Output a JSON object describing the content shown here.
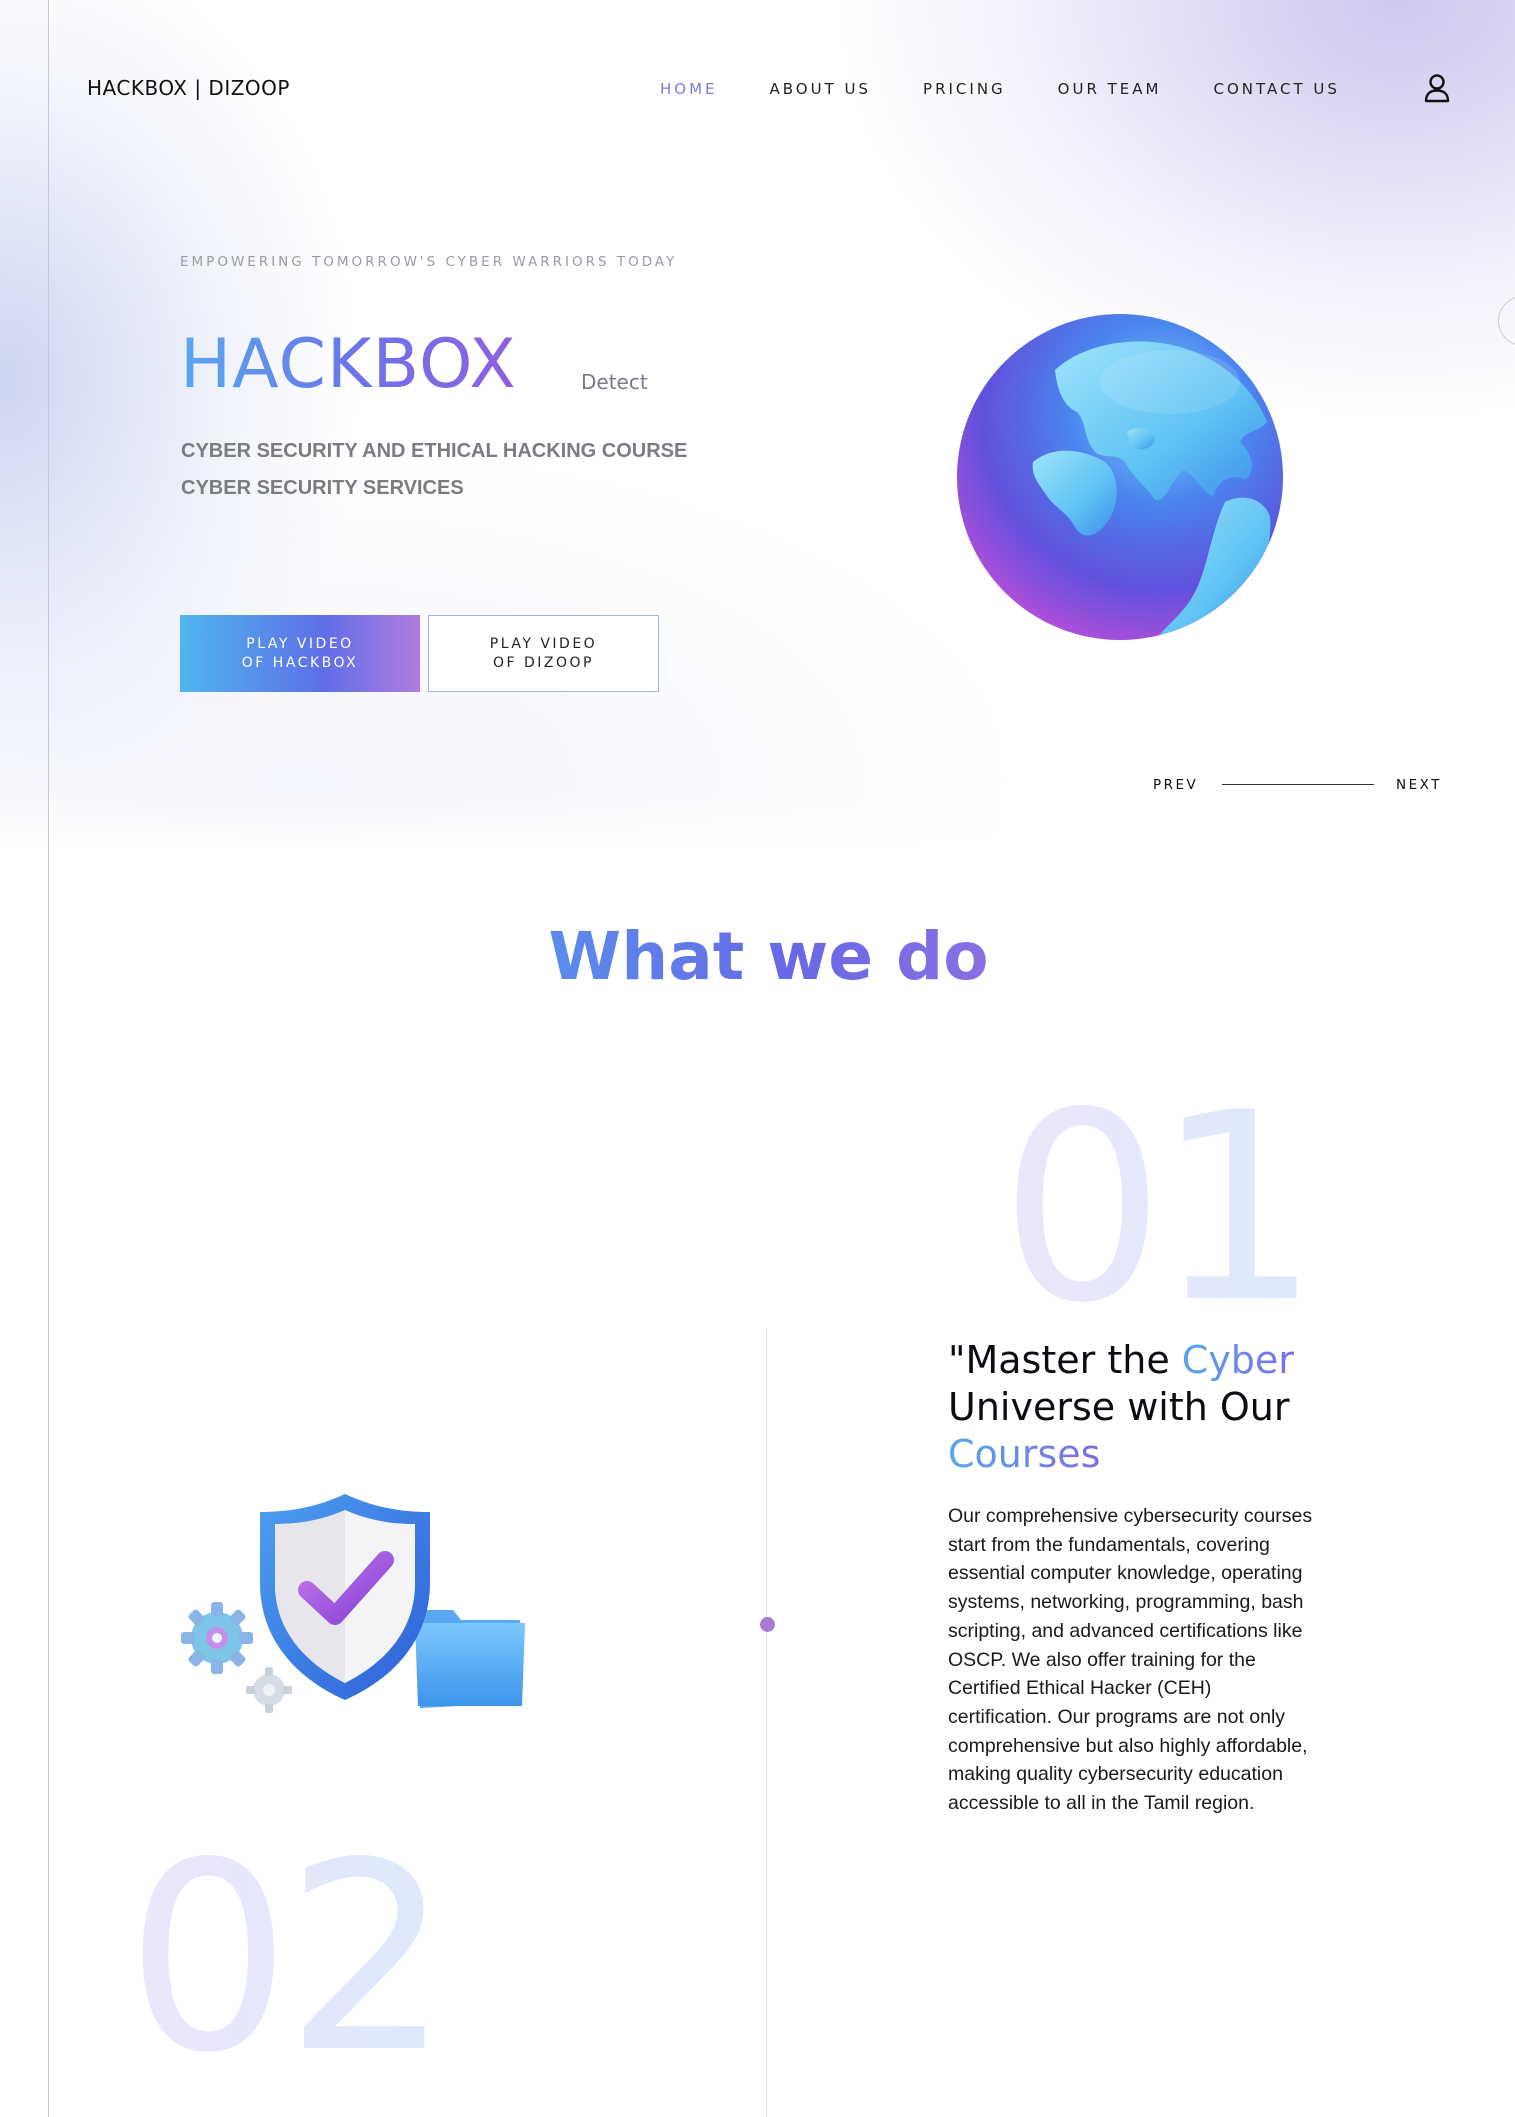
{
  "header": {
    "logo": "HACKBOX | DIZOOP",
    "nav": [
      {
        "label": "HOME",
        "active": true
      },
      {
        "label": "ABOUT US",
        "active": false
      },
      {
        "label": "PRICING",
        "active": false
      },
      {
        "label": "OUR TEAM",
        "active": false
      },
      {
        "label": "CONTACT US",
        "active": false
      }
    ],
    "user_icon": "user-icon"
  },
  "hero": {
    "eyebrow": "EMPOWERING TOMORROW'S CYBER WARRIORS TODAY",
    "title": "HACKBOX",
    "title_suffix": "Detect",
    "taglines": [
      "CYBER SECURITY AND ETHICAL HACKING COURSE",
      "CYBER SECURITY SERVICES"
    ],
    "primary_button": "PLAY VIDEO\nOF HACKBOX",
    "secondary_button": "PLAY VIDEO\nOF DIZOOP",
    "image": "globe-icon",
    "pager": {
      "prev": "PREV",
      "next": "NEXT"
    }
  },
  "what_we_do": {
    "title": "What we do",
    "items": [
      {
        "number": "01",
        "title_parts": [
          "\"Master the ",
          "Cyber",
          " Universe with Our ",
          "Courses"
        ],
        "body": "Our comprehensive cybersecurity courses start from the fundamentals, covering essential computer knowledge, operating systems, networking, programming, bash scripting, and advanced certifications like OSCP. We also offer training for the Certified Ethical Hacker (CEH) certification. Our programs are not only comprehensive but also highly affordable, making quality cybersecurity education accessible to all in the Tamil region.",
        "image": "shield-check-icon"
      },
      {
        "number": "02"
      }
    ]
  },
  "colors": {
    "accent_blue": "#59a8ee",
    "accent_indigo": "#6a76ea",
    "accent_purple": "#8f5ee0",
    "nav_active": "#7b7ce0",
    "timeline_dot": "#a77bd0"
  }
}
